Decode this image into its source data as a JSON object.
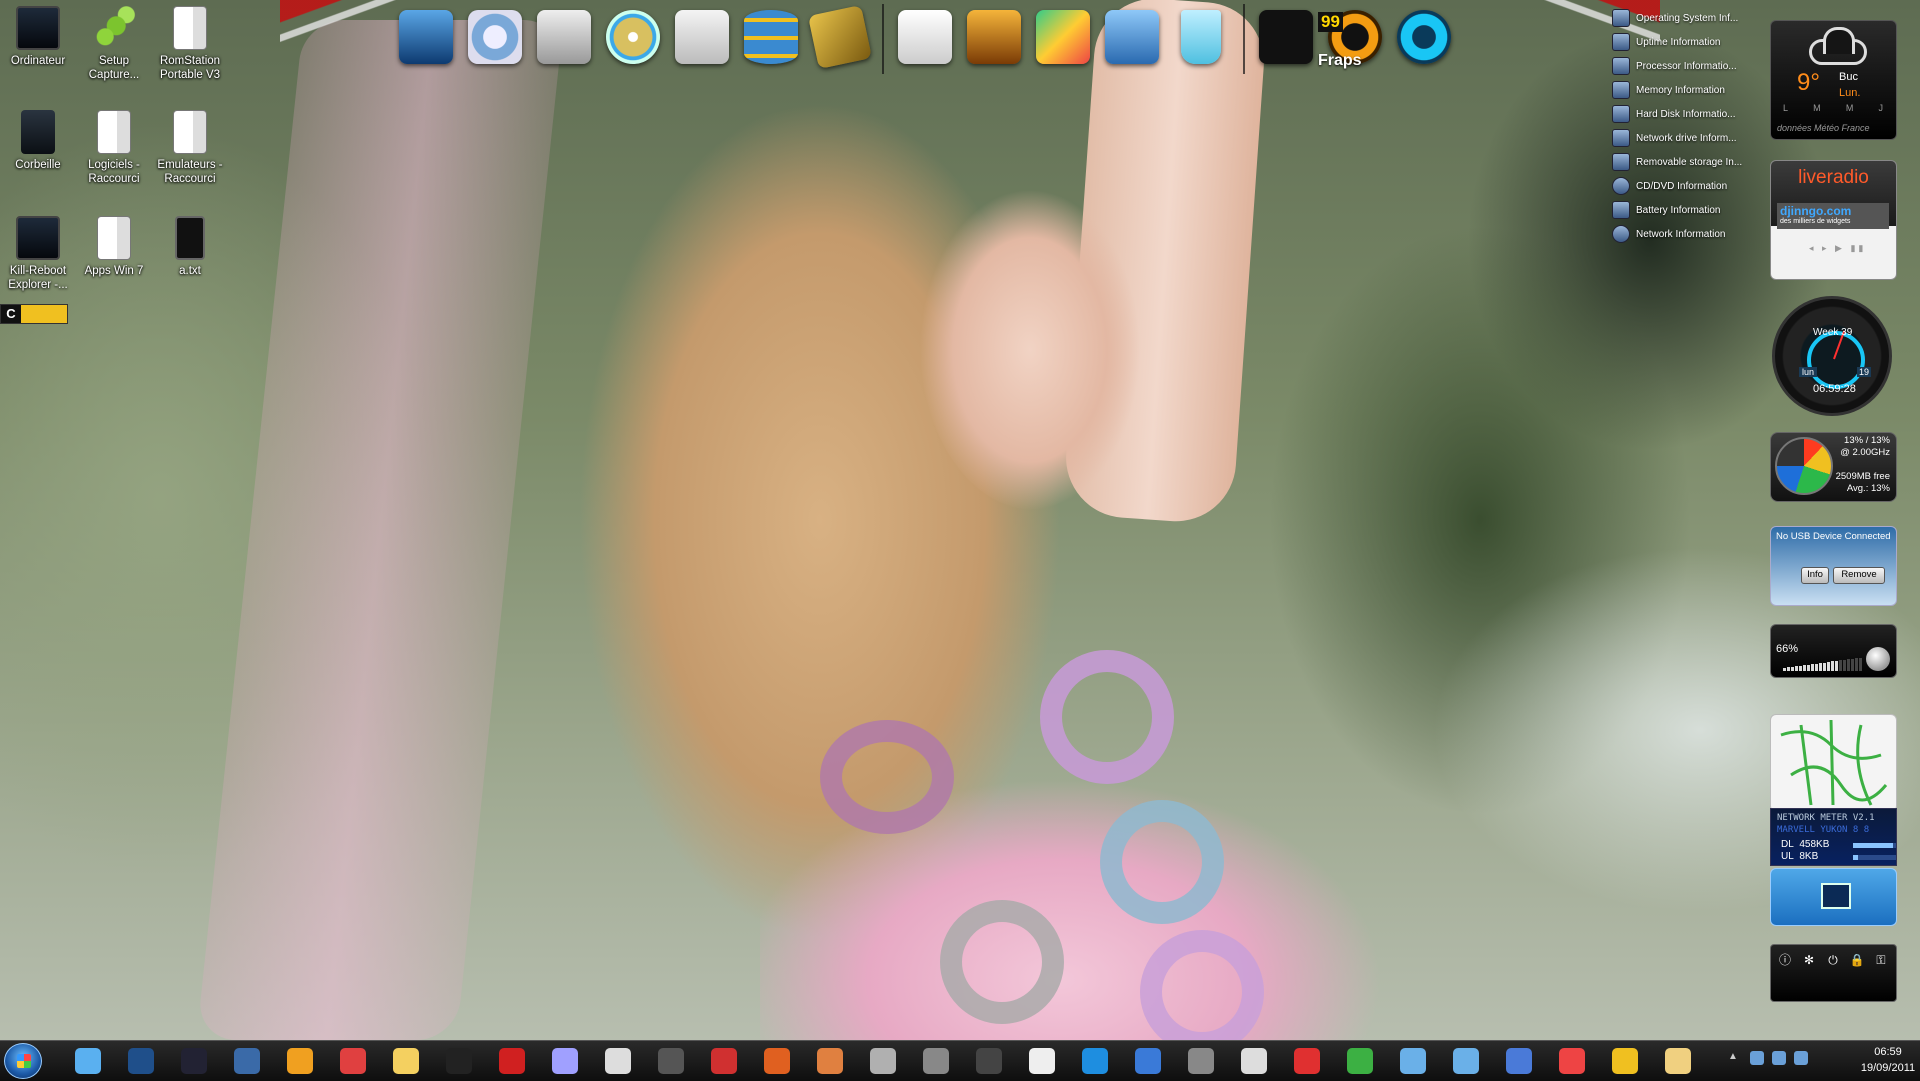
{
  "desktop_icons": [
    {
      "label": "Ordinateur"
    },
    {
      "label": "Setup Capture..."
    },
    {
      "label": "RomStation Portable V3"
    },
    {
      "label": "Corbeille"
    },
    {
      "label": "Logiciels - Raccourci"
    },
    {
      "label": "Emulateurs - Raccourci"
    },
    {
      "label": "Kill-Reboot Explorer -..."
    },
    {
      "label": "Apps Win 7"
    },
    {
      "label": "a.txt"
    }
  ],
  "cmd_widget": {
    "letter": "C"
  },
  "dock": {
    "items": [
      "monitor-icon",
      "hard-disk-icon",
      "drive-icon",
      "cd-icon",
      "disk-drive-icon",
      "database-icon",
      "dvd-case-icon",
      "document-icon",
      "music-icon",
      "paint-icon",
      "downloads-folder-icon",
      "trash-icon",
      "fraps-icon",
      "browser-e-icon",
      "browser-c-icon"
    ],
    "fraps_fps": "99",
    "fraps_label": "Fraps"
  },
  "info_list": [
    "Operating System Inf...",
    "Uptime Information",
    "Processor Informatio...",
    "Memory Information",
    "Hard Disk Informatio...",
    "Network drive Inform...",
    "Removable storage In...",
    "CD/DVD Information",
    "Battery Information",
    "Network Information"
  ],
  "weather": {
    "temp": "9°",
    "city": "Buc",
    "day": "Lun.",
    "days": [
      "L",
      "M",
      "M",
      "J"
    ],
    "source": "données Météo France"
  },
  "radio": {
    "title": "liveradio",
    "banner": "djinngo.com",
    "banner_sub": "des milliers de widgets"
  },
  "clock": {
    "week": "Week 39",
    "day": "lun",
    "date": "19",
    "time": "06:59:28"
  },
  "cpu": {
    "usage": "13% / 13%",
    "freq": "@ 2.00GHz",
    "memory": "2509MB free",
    "avg": "Avg.: 13%"
  },
  "usb": {
    "message": "No USB Device Connected",
    "info_button": "Info",
    "remove_button": "Remove"
  },
  "volume": {
    "percent": "66%",
    "level": 0.66
  },
  "network_meter": {
    "title": "NETWORK METER V2.1",
    "adapter": "MARVELL YUKON 8 8",
    "dl_label": "DL",
    "dl_value": "458KB",
    "dl_level": 0.8,
    "ul_label": "UL",
    "ul_value": "8KB",
    "ul_level": 0.1
  },
  "taskbar": {
    "time": "06:59",
    "date": "19/09/2011"
  },
  "colors": {
    "accent_orange": "#ff8c1a",
    "radio_red": "#ff5a2a",
    "clock_blue": "#19c6f5"
  }
}
